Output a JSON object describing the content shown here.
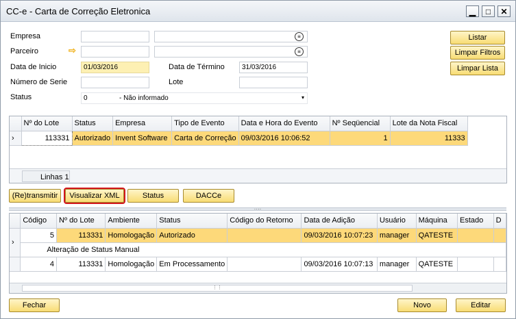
{
  "window": {
    "title": "CC-e - Carta de Correção Eletronica",
    "minimize": "▁",
    "maximize": "□",
    "close": "✕"
  },
  "form": {
    "empresa_label": "Empresa",
    "parceiro_label": "Parceiro",
    "data_inicio_label": "Data de Inicio",
    "data_inicio_value": "01/03/2016",
    "data_termino_label": "Data de Término",
    "data_termino_value": "31/03/2016",
    "numero_serie_label": "Número de Serie",
    "lote_label": "Lote",
    "status_label": "Status",
    "status_code": "0",
    "status_value": "- Não informado"
  },
  "actions": {
    "listar": "Listar",
    "limpar_filtros": "Limpar Filtros",
    "limpar_lista": "Limpar Lista"
  },
  "upper_grid": {
    "columns": [
      "Nº do Lote",
      "Status",
      "Empresa",
      "Tipo de Evento",
      "Data e Hora do Evento",
      "Nº Seqüencial",
      "Lote da Nota Fiscal"
    ],
    "rows": [
      [
        "113331",
        "Autorizado",
        "Invent Software",
        "Carta de Correção",
        "09/03/2016 10:06:52",
        "1",
        "11333"
      ]
    ],
    "footer": "Linhas 1"
  },
  "mid_buttons": {
    "retransmitir": "(Re)transmitir",
    "visualizar_xml": "Visualizar XML",
    "status": "Status",
    "dacce": "DACCe"
  },
  "lower_grid": {
    "columns": [
      "Código",
      "Nº do Lote",
      "Ambiente",
      "Status",
      "Código do Retorno",
      "Data de Adição",
      "Usuário",
      "Máquina",
      "Estado",
      "D"
    ],
    "rows": [
      [
        "5",
        "113331",
        "Homologação",
        "Autorizado",
        "",
        "09/03/2016 10:07:23",
        "manager",
        "QATESTE",
        "",
        ""
      ],
      [
        "4",
        "113331",
        "Homologação",
        "Em Processamento",
        "",
        "09/03/2016 10:07:13",
        "manager",
        "QATESTE",
        "",
        ""
      ]
    ],
    "group_label": "Alteração de Status Manual"
  },
  "bottom": {
    "fechar": "Fechar",
    "novo": "Novo",
    "editar": "Editar"
  }
}
